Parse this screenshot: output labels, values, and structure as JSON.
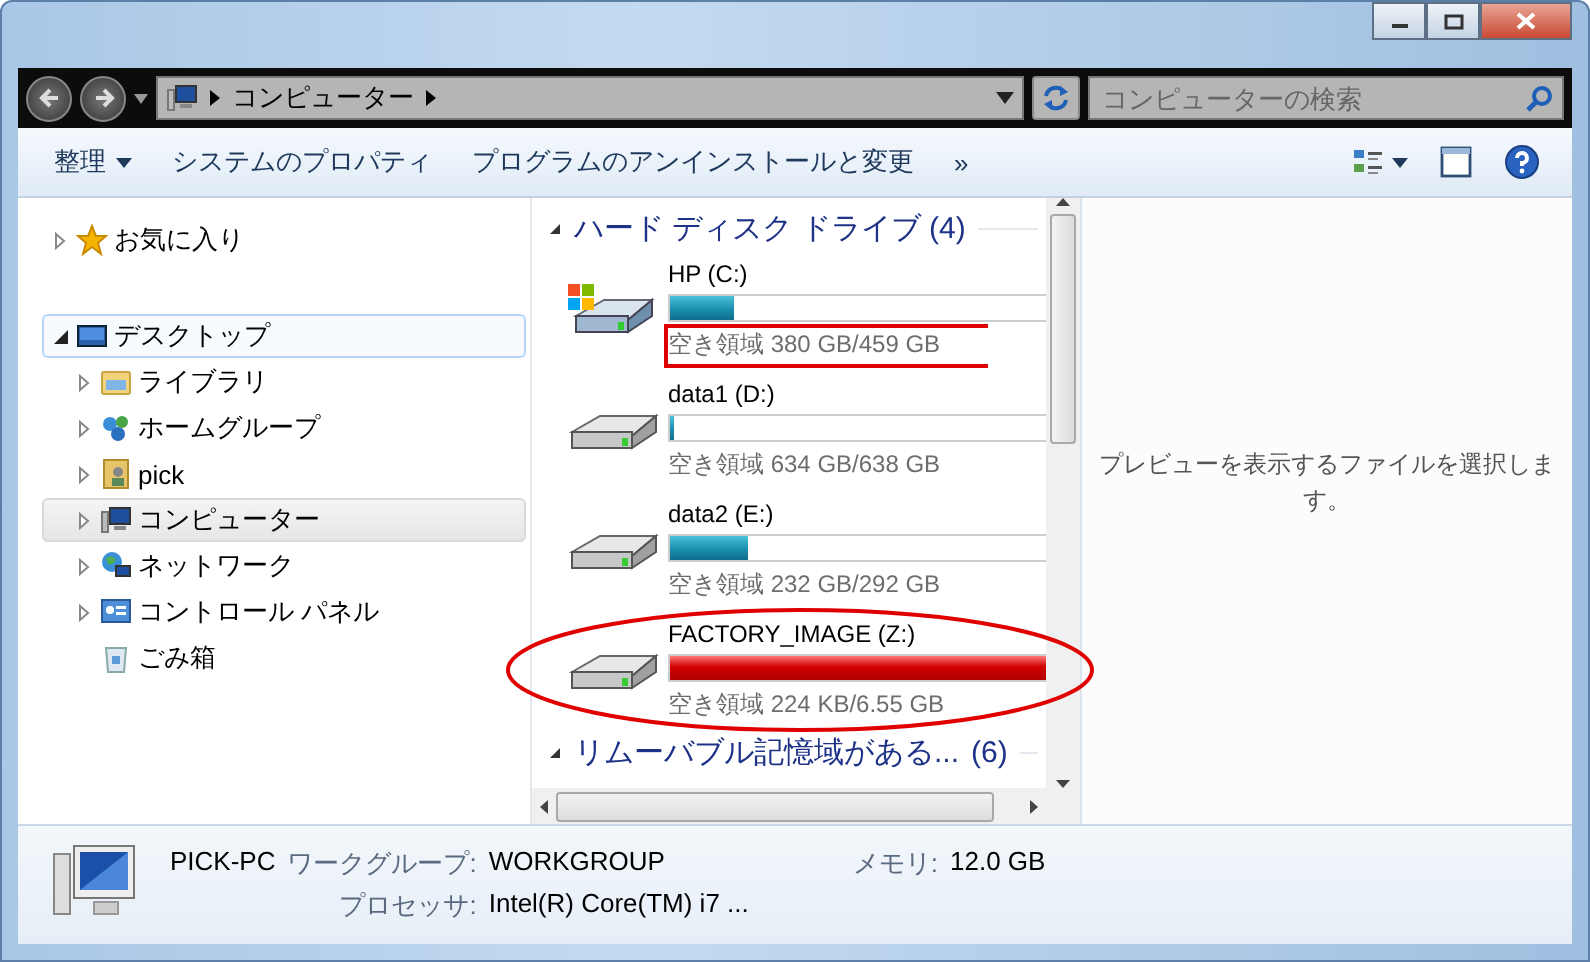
{
  "address_bar": {
    "breadcrumb": [
      "コンピューター"
    ],
    "search_placeholder": "コンピューターの検索"
  },
  "command_bar": {
    "items": [
      {
        "label": "整理",
        "dropdown": true
      },
      {
        "label": "システムのプロパティ",
        "dropdown": false
      },
      {
        "label": "プログラムのアンインストールと変更",
        "dropdown": false
      },
      {
        "label": "»",
        "dropdown": false
      }
    ]
  },
  "sidebar": {
    "items": [
      {
        "label": "お気に入り",
        "kind": "favorites",
        "expandable": true,
        "expanded": false,
        "selected": false,
        "focused": false
      },
      {
        "label": "デスクトップ",
        "kind": "desktop",
        "expandable": true,
        "expanded": true,
        "selected": false,
        "focused": true,
        "children": [
          {
            "label": "ライブラリ",
            "kind": "libraries",
            "expandable": true,
            "expanded": false,
            "selected": false,
            "focused": false
          },
          {
            "label": "ホームグループ",
            "kind": "homegroup",
            "expandable": true,
            "expanded": false,
            "selected": false,
            "focused": false
          },
          {
            "label": "pick",
            "kind": "user",
            "expandable": true,
            "expanded": false,
            "selected": false,
            "focused": false
          },
          {
            "label": "コンピューター",
            "kind": "computer",
            "expandable": true,
            "expanded": false,
            "selected": true,
            "focused": false
          },
          {
            "label": "ネットワーク",
            "kind": "network",
            "expandable": true,
            "expanded": false,
            "selected": false,
            "focused": false
          },
          {
            "label": "コントロール パネル",
            "kind": "control-panel",
            "expandable": true,
            "expanded": false,
            "selected": false,
            "focused": false
          },
          {
            "label": "ごみ箱",
            "kind": "recycle-bin",
            "expandable": false,
            "selected": false,
            "focused": false
          }
        ]
      }
    ]
  },
  "content": {
    "groups": [
      {
        "title": "ハード ディスク ドライブ (4)",
        "expanded": true,
        "drives": [
          {
            "name": "HP (C:)",
            "kind": "system",
            "level": 0.17,
            "low_space": false,
            "free": "空き領域 380 GB/459 GB",
            "boxed": true,
            "circled": false
          },
          {
            "name": "data1 (D:)",
            "kind": "plain",
            "level": 0.01,
            "low_space": false,
            "free": "空き領域 634 GB/638 GB",
            "boxed": false,
            "circled": false
          },
          {
            "name": "data2 (E:)",
            "kind": "plain",
            "level": 0.21,
            "low_space": false,
            "free": "空き領域 232 GB/292 GB",
            "boxed": false,
            "circled": false
          },
          {
            "name": "FACTORY_IMAGE (Z:)",
            "kind": "plain",
            "level": 1.0,
            "low_space": true,
            "free": "空き領域 224 KB/6.55 GB",
            "boxed": false,
            "circled": true
          }
        ]
      },
      {
        "title": "リムーバブル記憶域がある...",
        "count": "(6)",
        "expanded": true
      }
    ]
  },
  "preview": {
    "message": "プレビューを表示するファイルを選択します。"
  },
  "details_pane": {
    "name": "PICK-PC",
    "fields": [
      {
        "label": "ワークグループ:",
        "value": "WORKGROUP"
      },
      {
        "label": "メモリ:",
        "value": "12.0 GB"
      },
      {
        "label": "プロセッサ:",
        "value": "Intel(R) Core(TM) i7 ..."
      }
    ]
  }
}
